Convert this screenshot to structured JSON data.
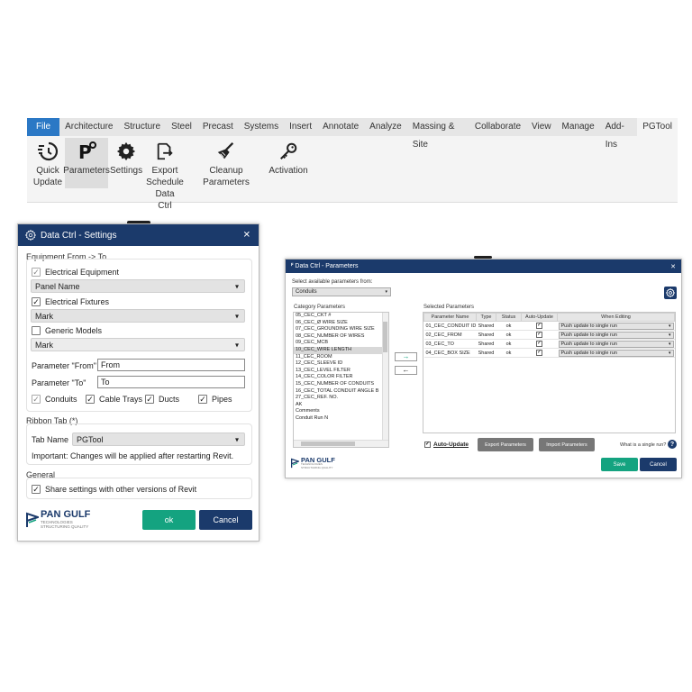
{
  "ribbon": {
    "tabs": [
      "File",
      "Architecture",
      "Structure",
      "Steel",
      "Precast",
      "Systems",
      "Insert",
      "Annotate",
      "Analyze",
      "Massing & Site",
      "Collaborate",
      "View",
      "Manage",
      "Add-Ins",
      "PGTool"
    ],
    "buttons": [
      {
        "label1": "Quick",
        "label2": "Update",
        "label3": "",
        "icon": "quick-update-icon"
      },
      {
        "label1": "Parameters",
        "label2": "",
        "label3": "",
        "icon": "parameters-icon"
      },
      {
        "label1": "Settings",
        "label2": "",
        "label3": "",
        "icon": "gear-icon"
      },
      {
        "label1": "Export",
        "label2": "Schedule",
        "label3": "Data Ctrl",
        "icon": "export-schedule-icon"
      },
      {
        "label1": "Cleanup Parameters",
        "label2": "",
        "label3": "",
        "icon": "broom-icon"
      },
      {
        "label1": "Activation",
        "label2": "",
        "label3": "",
        "icon": "key-icon"
      }
    ]
  },
  "settings": {
    "title": "Data Ctrl - Settings",
    "section_equipment": "Equipment From -> To",
    "electrical_equipment": "Electrical Equipment",
    "dd1": "Panel Name",
    "electrical_fixtures": "Electrical Fixtures",
    "dd2": "Mark",
    "generic_models": "Generic Models",
    "dd3": "Mark",
    "param_from_label": "Parameter \"From\"",
    "param_from_value": "From",
    "param_to_label": "Parameter \"To\"",
    "param_to_value": "To",
    "conduits": "Conduits",
    "cable_trays": "Cable Trays",
    "ducts": "Ducts",
    "pipes": "Pipes",
    "section_ribbon": "Ribbon Tab (*)",
    "tab_name_label": "Tab Name",
    "tab_name_value": "PGTool",
    "important": "Important: Changes will be applied after restarting Revit.",
    "section_general": "General",
    "share": "Share settings with other versions of Revit",
    "ok": "ok",
    "cancel": "Cancel"
  },
  "logo": {
    "line1": "PAN GULF",
    "line2": "TECHNOLOGIES",
    "line3": "STRUCTURING QUALITY"
  },
  "params": {
    "title": "Data Ctrl - Parameters",
    "select_label": "Select available parameters from:",
    "select_value": "Conduits",
    "category_label": "Category Parameters",
    "category_items": [
      "05_CEC_CKT #",
      "06_CEC_Ø WIRE SIZE",
      "07_CEC_GROUNDING WIRE SIZE",
      "08_CEC_NUMBER OF WIRES",
      "09_CEC_MCB",
      "10_CEC_WIRE LENGTH",
      "11_CEC_ROOM",
      "12_CEC_SLEEVE ID",
      "13_CEC_LEVEL FILTER",
      "14_CEC_COLOR FILTER",
      "15_CEC_NUMBER OF CONDUITS",
      "16_CEC_TOTAL CONDUIT ANGLE B",
      "27_CEC_REF. NO.",
      "AK",
      "Comments",
      "Conduit Run N"
    ],
    "selected_label": "Selected Parameters",
    "columns": [
      "Parameter Name",
      "Type",
      "Status",
      "Auto-Update",
      "When Editing"
    ],
    "rows": [
      {
        "name": "01_CEC_CONDUIT ID",
        "type": "Shared",
        "status": "ok",
        "when": "Push update to single run"
      },
      {
        "name": "02_CEC_FROM",
        "type": "Shared",
        "status": "ok",
        "when": "Push update to single run"
      },
      {
        "name": "03_CEC_TO",
        "type": "Shared",
        "status": "ok",
        "when": "Push update to single run"
      },
      {
        "name": "04_CEC_BOX SIZE",
        "type": "Shared",
        "status": "ok",
        "when": "Push update to single run"
      }
    ],
    "auto_update": "Auto-Update",
    "export": "Export Parameters",
    "import": "Import Parameters",
    "single_run": "What is a single run?",
    "save": "Save",
    "cancel": "Cancel"
  },
  "colors": {
    "navy": "#1b3a6b",
    "green": "#14a380",
    "file_tab": "#2b78c5"
  }
}
